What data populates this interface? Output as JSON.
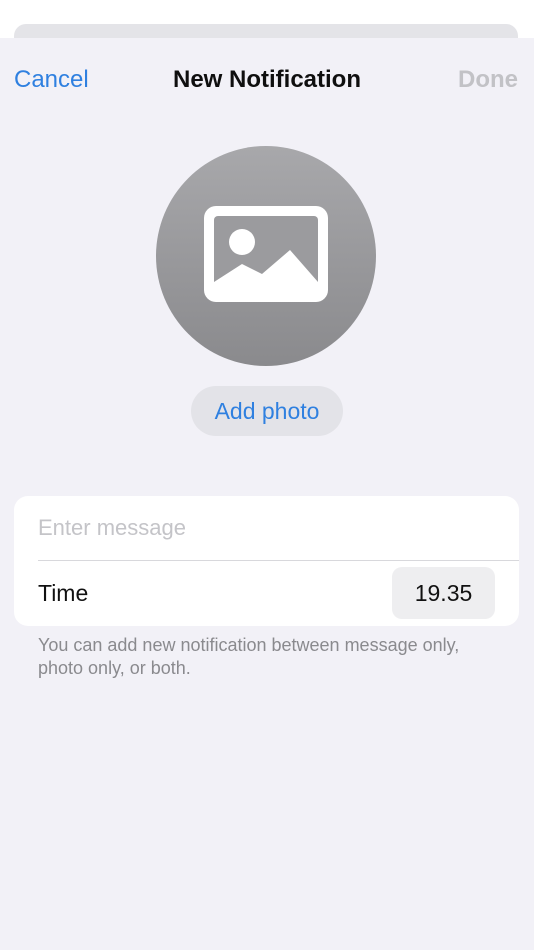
{
  "nav": {
    "cancel_label": "Cancel",
    "title": "New Notification",
    "done_label": "Done"
  },
  "photo": {
    "placeholder_icon": "photo-placeholder-icon",
    "add_label": "Add photo"
  },
  "form": {
    "message_placeholder": "Enter message",
    "message_value": "",
    "time_label": "Time",
    "time_value": "19.35"
  },
  "helper_text": "You can add new notification between message only, photo only, or both.",
  "colors": {
    "accent": "#2f80e0",
    "disabled": "#c2c2c6",
    "background": "#f2f1f7",
    "card": "#ffffff",
    "avatar": "#9a9a9d"
  }
}
